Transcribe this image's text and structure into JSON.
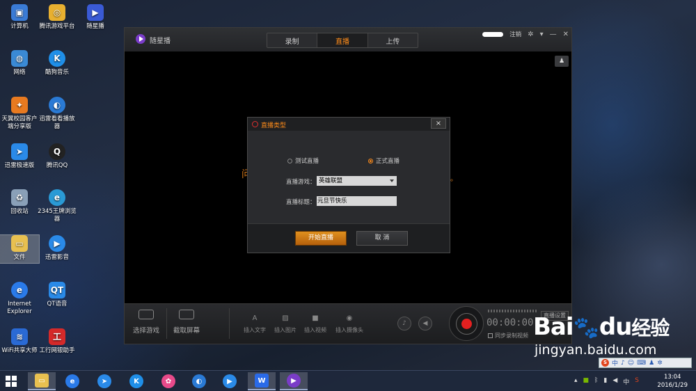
{
  "desktop": {
    "icons": [
      {
        "label": "计算机",
        "color": "#3a7bd5"
      },
      {
        "label": "腾讯游戏平台",
        "color": "#e8b030"
      },
      {
        "label": "随星播",
        "color": "#3a5ad5"
      },
      {
        "label": "网络",
        "color": "#3a8ad5"
      },
      {
        "label": "酷狗音乐",
        "color": "#1f8fe8"
      },
      {
        "label": "天翼校园客户端分享版",
        "color": "#e87a20"
      },
      {
        "label": "迅雷看看播放器",
        "color": "#2a7ad5"
      },
      {
        "label": "迅雷极速版",
        "color": "#2a8ae8"
      },
      {
        "label": "腾讯QQ",
        "color": "#222222"
      },
      {
        "label": "回收站",
        "color": "#8aa0b8"
      },
      {
        "label": "2345王牌浏览器",
        "color": "#2a9ad5"
      },
      {
        "label": "文件",
        "color": "#e8c050"
      },
      {
        "label": "迅雷影音",
        "color": "#2a8ae8"
      },
      {
        "label": "Internet Explorer",
        "color": "#2a7ae8"
      },
      {
        "label": "QT语音",
        "color": "#2a8ae8"
      },
      {
        "label": "WiFi共享大师",
        "color": "#2a6ad5"
      },
      {
        "label": "工行网银助手",
        "color": "#d52a2a"
      }
    ]
  },
  "app": {
    "title": "随星播",
    "tabs": [
      {
        "label": "录制",
        "active": false
      },
      {
        "label": "直播",
        "active": true
      },
      {
        "label": "上传",
        "active": false
      }
    ],
    "logout_label": "注销",
    "background_hint": "问",
    "background_hint_tail": "。"
  },
  "dialog": {
    "title": "直播类型",
    "close_label": "×",
    "radio_test": "测试直播",
    "radio_official": "正式直播",
    "selected_mode": "正式直播",
    "game_label": "直播游戏：",
    "game_value": "英雄联盟",
    "title_label": "直播标题：",
    "title_value": "元旦节快乐",
    "start_button": "开始直播",
    "cancel_button": "取  消"
  },
  "toolbar": {
    "select_game": "选择游戏",
    "capture_screen": "截取屏幕",
    "insert_text": "插入文字",
    "insert_image": "插入图片",
    "insert_video": "插入视频",
    "insert_camera": "插入摄像头",
    "timer": "00:00:00",
    "sync_record": "同步录制视频",
    "live_settings": "直播设置"
  },
  "watermark": {
    "logo": "Bai",
    "logo_tail": "du",
    "logo_cn": "经验",
    "subtitle": "jingyan.baidu.com"
  },
  "ime": {
    "lang": "中"
  },
  "taskbar": {
    "tray_lang": "中",
    "time": "13:04",
    "date": "2016/1/29",
    "apps": [
      {
        "name": "file-explorer",
        "color": "#e8c050",
        "glyph": "▭"
      },
      {
        "name": "ie",
        "color": "#2a7ae8",
        "glyph": "e"
      },
      {
        "name": "xunlei",
        "color": "#2a8ae8",
        "glyph": "➤"
      },
      {
        "name": "kugou",
        "color": "#1f8fe8",
        "glyph": "K"
      },
      {
        "name": "photo",
        "color": "#e84a8a",
        "glyph": "✿"
      },
      {
        "name": "xunlei-kankan",
        "color": "#2a7ad5",
        "glyph": "◐"
      },
      {
        "name": "player",
        "color": "#2a8ae8",
        "glyph": "▶"
      },
      {
        "name": "wps",
        "color": "#2a6ae8",
        "glyph": "W"
      },
      {
        "name": "suixingbo",
        "color": "#7a3cc8",
        "glyph": "▶"
      }
    ]
  }
}
